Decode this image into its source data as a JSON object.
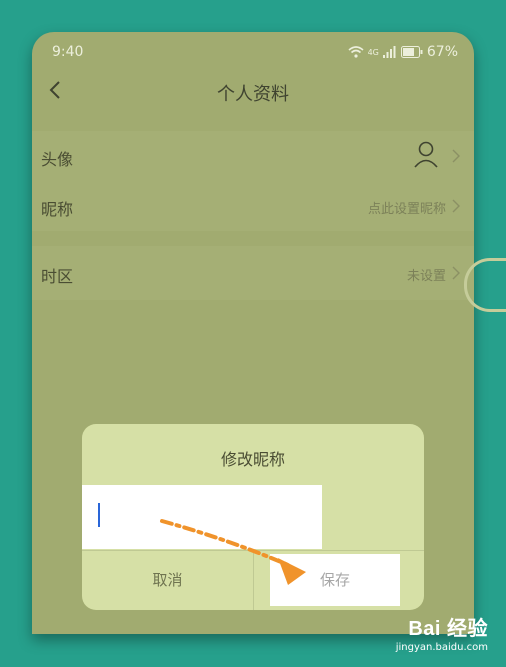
{
  "status_bar": {
    "time": "9:40",
    "battery": "67%",
    "network": "4G"
  },
  "header": {
    "title": "个人资料"
  },
  "rows": [
    {
      "label": "头像",
      "value": ""
    },
    {
      "label": "昵称",
      "value": "点此设置昵称"
    },
    {
      "label": "时区",
      "value": "未设置"
    }
  ],
  "dialog": {
    "title": "修改昵称",
    "input_value": "",
    "cancel_label": "取消",
    "save_label": "保存"
  },
  "watermark": {
    "brand": "Bai 经验",
    "url": "jingyan.baidu.com"
  },
  "colors": {
    "backdrop": "#26a08c",
    "screen": "#a1ab70",
    "dialog": "#d6e0a6",
    "arrow": "#f0932b",
    "cursor": "#2a66d8"
  }
}
